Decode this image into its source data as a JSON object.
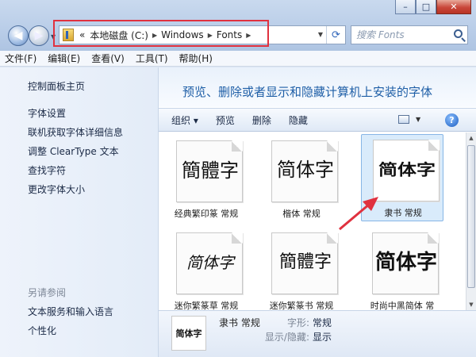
{
  "window": {
    "minimize_label": "–",
    "maximize_label": "□",
    "close_label": "✕"
  },
  "address": {
    "root_chevron": "«",
    "segments": [
      "本地磁盘 (C:)",
      "Windows",
      "Fonts"
    ],
    "highlight_color": "#e0313f"
  },
  "search": {
    "placeholder": "搜索 Fonts"
  },
  "menubar": {
    "items": [
      "文件(F)",
      "编辑(E)",
      "查看(V)",
      "工具(T)",
      "帮助(H)"
    ]
  },
  "sidebar": {
    "home": "控制面板主页",
    "links": [
      "字体设置",
      "联机获取字体详细信息",
      "调整 ClearType 文本",
      "查找字符",
      "更改字体大小"
    ],
    "see_also_title": "另请参阅",
    "see_also": [
      "文本服务和输入语言",
      "个性化"
    ]
  },
  "main": {
    "banner_title": "预览、删除或者显示和隐藏计算机上安装的字体",
    "toolbar": {
      "organize": "组织 ▾",
      "preview": "预览",
      "delete": "删除",
      "hide": "隐藏",
      "help": "?"
    }
  },
  "fonts": [
    {
      "sample": "簡體字",
      "name": "经典繁印篆 常规",
      "selected": false
    },
    {
      "sample": "简体字",
      "name": "楷体 常规",
      "selected": false
    },
    {
      "sample": "简体字",
      "name": "隶书 常规",
      "selected": true
    },
    {
      "sample": "简体字",
      "name": "迷你繁篆草 常规",
      "selected": false
    },
    {
      "sample": "簡體字",
      "name": "迷你繁篆书 常规",
      "selected": false
    },
    {
      "sample": "简体字",
      "name": "时尚中黑简体 常",
      "selected": false
    }
  ],
  "details": {
    "thumb_text": "简体字",
    "name": "隶书 常规",
    "style_label": "字形:",
    "style_value": "常规",
    "visibility_label": "显示/隐藏:",
    "visibility_value": "显示"
  },
  "annotation": {
    "arrow_color": "#e0313f"
  }
}
